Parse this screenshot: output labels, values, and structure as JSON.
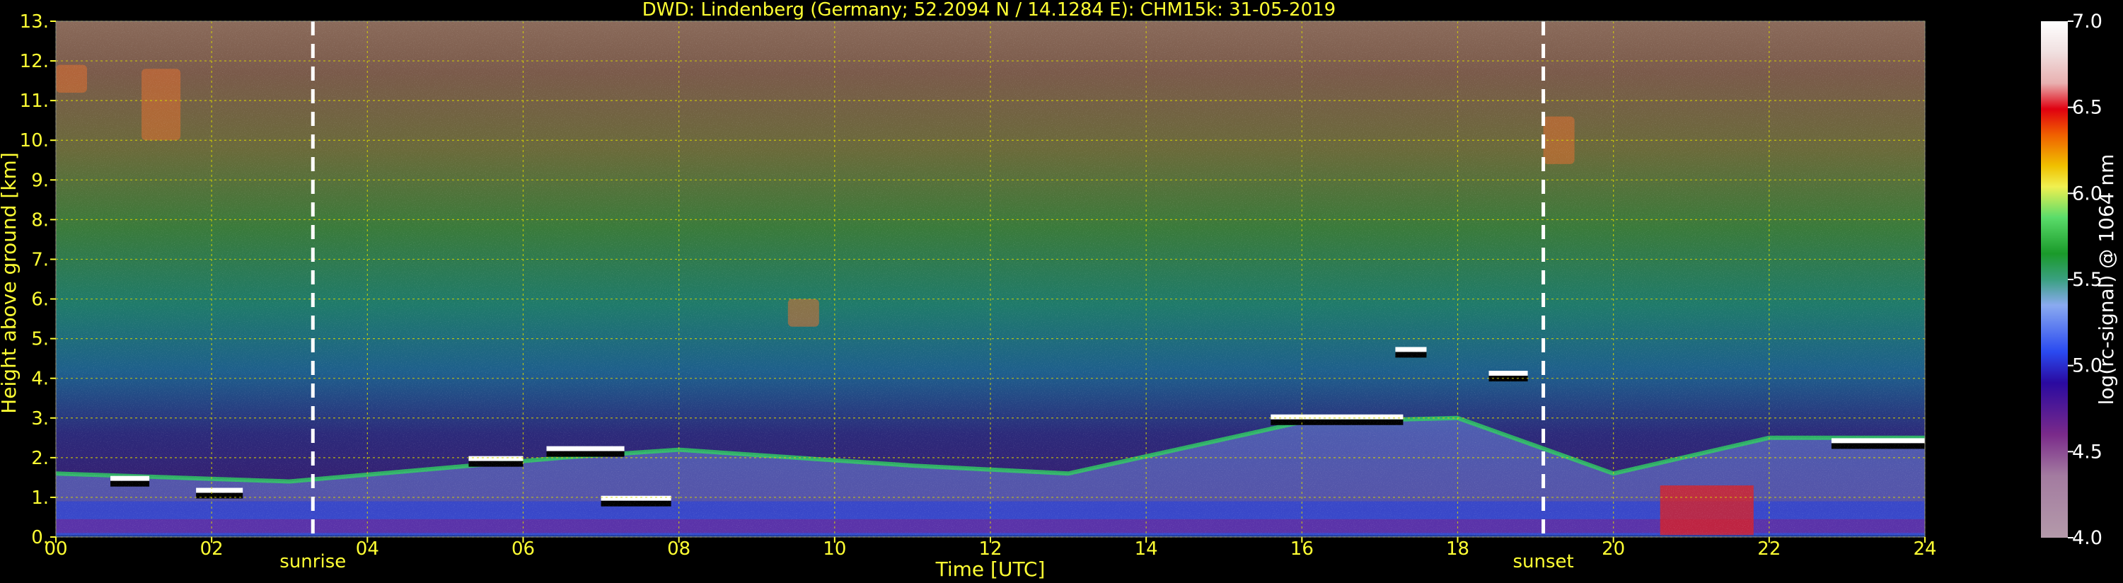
{
  "chart_data": {
    "type": "heatmap",
    "title": "DWD: Lindenberg (Germany; 52.2094 N / 14.1284 E):    CHM15k: 31-05-2019",
    "xlabel": "Time [UTC]",
    "ylabel": "Height above ground [km]",
    "xlim": [
      0,
      24
    ],
    "ylim": [
      0,
      13
    ],
    "x_ticks": [
      "00",
      "02",
      "04",
      "06",
      "08",
      "10",
      "12",
      "14",
      "16",
      "18",
      "20",
      "22",
      "24"
    ],
    "y_ticks": [
      "0.",
      "1.",
      "2.",
      "3.",
      "4.",
      "5.",
      "6.",
      "7.",
      "8.",
      "9.",
      "10.",
      "11.",
      "12.",
      "13."
    ],
    "grid": true,
    "markers": [
      {
        "label": "sunrise",
        "time": 3.3
      },
      {
        "label": "sunset",
        "time": 19.1
      }
    ],
    "colorbar": {
      "label": "log(rc-signal) @ 1064 nm",
      "min": 4.0,
      "max": 7.0,
      "ticks": [
        "4.0",
        "4.5",
        "5.0",
        "5.5",
        "6.0",
        "6.5",
        "7.0"
      ]
    },
    "features": {
      "boundary_layer_top_km": [
        {
          "t": 0.0,
          "h": 1.6
        },
        {
          "t": 3.0,
          "h": 1.4
        },
        {
          "t": 6.5,
          "h": 2.0
        },
        {
          "t": 8.0,
          "h": 2.2
        },
        {
          "t": 11.0,
          "h": 1.8
        },
        {
          "t": 13.0,
          "h": 1.6
        },
        {
          "t": 16.0,
          "h": 2.9
        },
        {
          "t": 18.0,
          "h": 3.0
        },
        {
          "t": 20.0,
          "h": 1.6
        },
        {
          "t": 22.0,
          "h": 2.5
        },
        {
          "t": 24.0,
          "h": 2.5
        }
      ],
      "cloud_layers": [
        {
          "t_start": 0.7,
          "t_end": 1.2,
          "h": 1.45
        },
        {
          "t_start": 1.8,
          "t_end": 2.4,
          "h": 1.15
        },
        {
          "t_start": 5.3,
          "t_end": 6.0,
          "h": 1.95
        },
        {
          "t_start": 6.3,
          "t_end": 7.3,
          "h": 2.2
        },
        {
          "t_start": 7.0,
          "t_end": 7.9,
          "h": 0.95
        },
        {
          "t_start": 15.6,
          "t_end": 17.3,
          "h": 3.0
        },
        {
          "t_start": 17.2,
          "t_end": 17.6,
          "h": 4.7
        },
        {
          "t_start": 18.4,
          "t_end": 18.9,
          "h": 4.1
        },
        {
          "t_start": 22.8,
          "t_end": 24.0,
          "h": 2.4
        }
      ],
      "cirrus_patches": [
        {
          "t_start": 0.0,
          "t_end": 0.4,
          "h_low": 11.2,
          "h_high": 11.9
        },
        {
          "t_start": 1.1,
          "t_end": 1.6,
          "h_low": 10.0,
          "h_high": 11.8
        },
        {
          "t_start": 19.1,
          "t_end": 19.5,
          "h_low": 9.4,
          "h_high": 10.6
        },
        {
          "t_start": 9.4,
          "t_end": 9.8,
          "h_low": 5.3,
          "h_high": 6.0
        }
      ]
    }
  }
}
